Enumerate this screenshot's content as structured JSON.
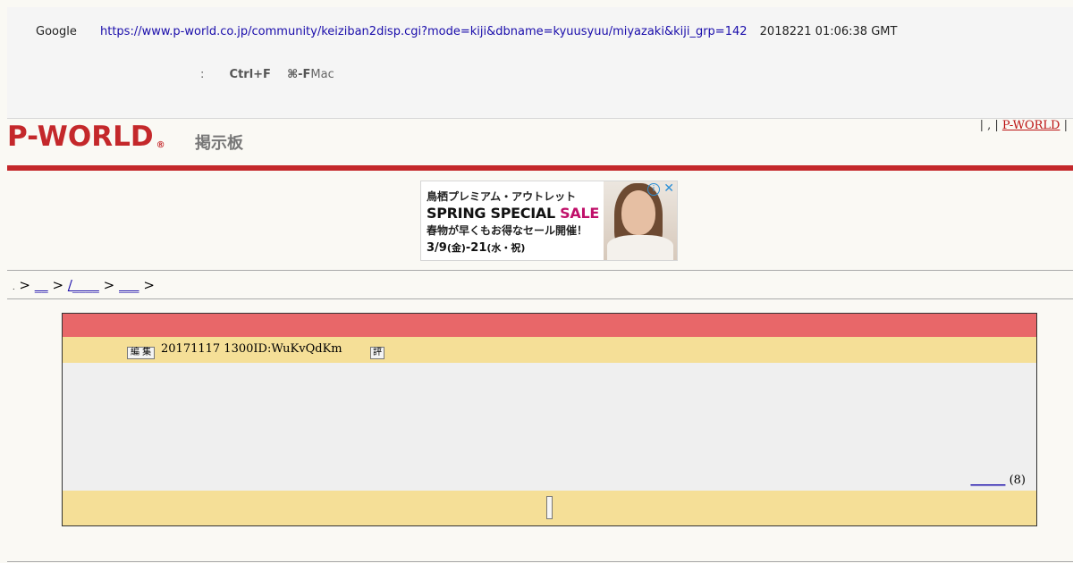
{
  "cache": {
    "google_label": "Google",
    "url": "https://www.p-world.co.jp/community/keiziban2disp.cgi?mode=kiji&dbname=kyuusyuu/miyazaki&kiji_grp=142",
    "date": "2018221 01:06:38 GMT",
    "hint_colon": ":",
    "hint_key1": "Ctrl+F",
    "hint_key2": "⌘-F",
    "hint_mac": "Mac"
  },
  "site": {
    "logo": "P-WORLD",
    "reg": "®",
    "board_title": "掲示板",
    "toplinks_prefix": "| , |",
    "toplinks_link": "P-WORLD",
    "toplinks_suffix": "|"
  },
  "ad": {
    "line1": "鳥栖プレミアム・アウトレット",
    "line2a": "SPRING SPECIAL ",
    "line2b": "SALE",
    "line3": "春物が早くもお得なセール開催！",
    "line4a": "3/9",
    "line4b": "(金)",
    "line4c": "-21",
    "line4d": "(水・祝)",
    "info": "i",
    "close": "✕"
  },
  "breadcrumb": {
    "dot": ".",
    "sep": ">",
    "link1": "__",
    "link2": "/____",
    "link3": "___"
  },
  "post": {
    "edit_label": "編 集",
    "meta": "20171117 1300ID:WuKvQdKm",
    "eval_label": "評",
    "reply_link": "______",
    "reply_count": "(8)"
  }
}
